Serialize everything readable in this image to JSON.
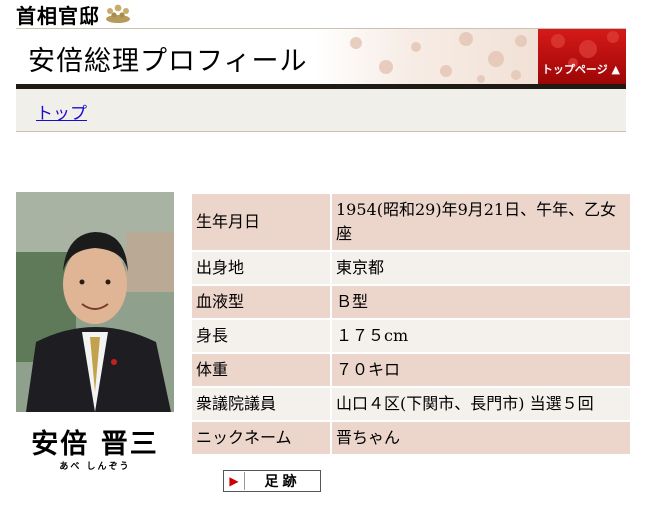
{
  "site": {
    "logo_text": "首相官邸"
  },
  "banner": {
    "title": "安倍総理プロフィール",
    "top_page_link": "トップページ ▲",
    "accent_color": "#c1121f"
  },
  "breadcrumb": {
    "home_link": "トップ"
  },
  "photo": {
    "alt": "安倍晋三"
  },
  "name": {
    "kanji": "安倍 晋三",
    "kana": "あべ しんぞう"
  },
  "profile": [
    {
      "label": "生年月日",
      "value": "1954(昭和29)年9月21日、午年、乙女座"
    },
    {
      "label": "出身地",
      "value": "東京都"
    },
    {
      "label": "血液型",
      "value": "Ｂ型"
    },
    {
      "label": "身長",
      "value": "１７５cm"
    },
    {
      "label": "体重",
      "value": "７０キロ"
    },
    {
      "label": "衆議院議員",
      "value": "山口４区(下関市、長門市) 当選５回"
    },
    {
      "label": "ニックネーム",
      "value": "晋ちゃん"
    }
  ],
  "footprint_button": {
    "label": "足跡",
    "icon": "play-arrow-icon"
  }
}
